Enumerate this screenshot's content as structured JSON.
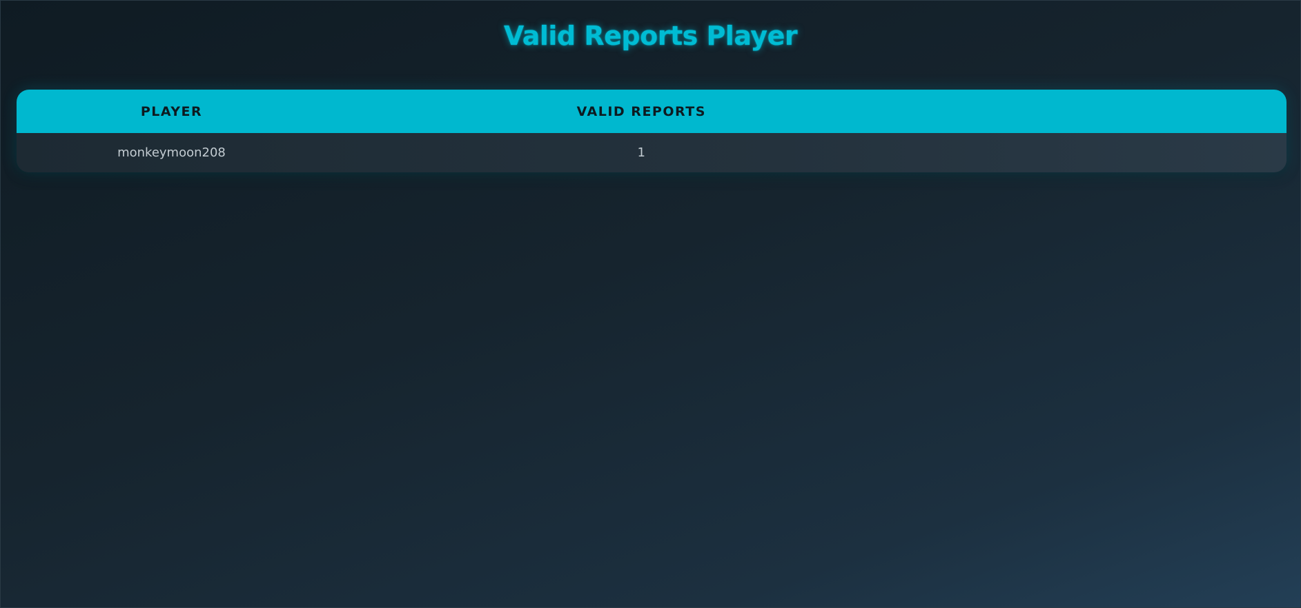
{
  "page": {
    "title": "Valid Reports Player"
  },
  "table": {
    "columns": [
      "PLAYER",
      "VALID REPORTS"
    ],
    "rows": [
      {
        "player": "monkeymoon208",
        "valid_reports": "1"
      }
    ]
  },
  "colors": {
    "accent": "#00bcd4",
    "header_bg": "#00b8cf",
    "background_dark": "#0f1b23",
    "background_light": "#233f56",
    "row_bg": "#24323d",
    "text": "#c3ccd2"
  }
}
